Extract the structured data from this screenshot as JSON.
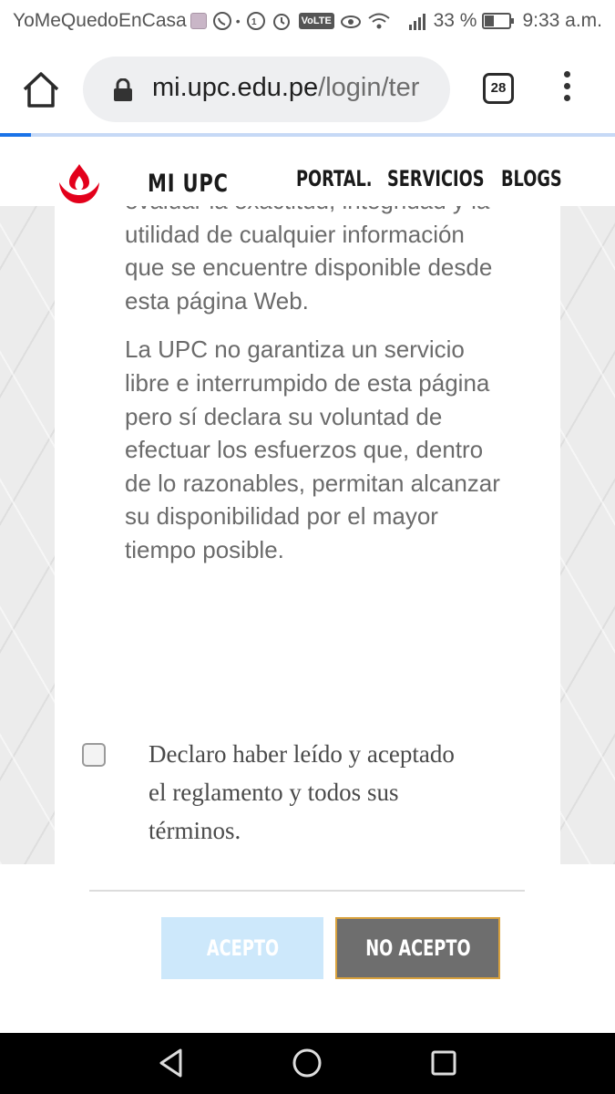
{
  "status_bar": {
    "notification_text": "YoMeQuedoEnCasa",
    "volte_label": "VoLTE",
    "battery_percent": "33 %",
    "time": "9:33 a.m."
  },
  "browser": {
    "url_host": "mi.upc.edu.pe",
    "url_path": "/login/ter",
    "tab_count": "28",
    "load_progress": 0.05
  },
  "site_header": {
    "title": "MI UPC",
    "nav": [
      "PORTAL.",
      "SERVICIOS",
      "BLOGS"
    ],
    "logo_color": "#e3001b"
  },
  "terms": {
    "paragraph_1": "evaluar la exactitud, integridad y la utilidad de cualquier información que se encuentre disponible desde esta página Web.",
    "paragraph_2": "La UPC no garantiza un servicio libre e interrumpido de esta página pero sí declara su voluntad de efectuar los esfuerzos que, dentro de lo razonables, permitan alcanzar su disponibilidad por el mayor tiempo posible."
  },
  "agreement": {
    "checked": false,
    "label": "Declaro haber leído y aceptado el reglamento y todos sus términos."
  },
  "buttons": {
    "accept_label": "ACEPTO",
    "reject_label": "NO ACEPTO",
    "accept_color": "#cde8fb",
    "reject_color": "#6e6e6e"
  }
}
